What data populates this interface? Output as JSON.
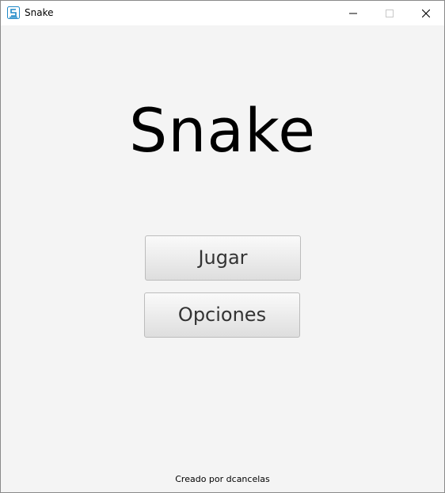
{
  "window": {
    "title": "Snake",
    "controls": [
      "minimize",
      "maximize",
      "close"
    ]
  },
  "main": {
    "title": "Snake",
    "buttons": {
      "play_label": "Jugar",
      "options_label": "Opciones"
    },
    "footer": "Creado por dcancelas"
  },
  "icons": {
    "app": "app-icon",
    "minimize": "minimize-icon",
    "maximize": "maximize-icon",
    "close": "close-icon"
  },
  "colors": {
    "background": "#f4f4f4",
    "titlebar": "#ffffff",
    "app_icon": "#1e88c7",
    "button_border": "#bcbcbc",
    "button_text": "#333333"
  }
}
